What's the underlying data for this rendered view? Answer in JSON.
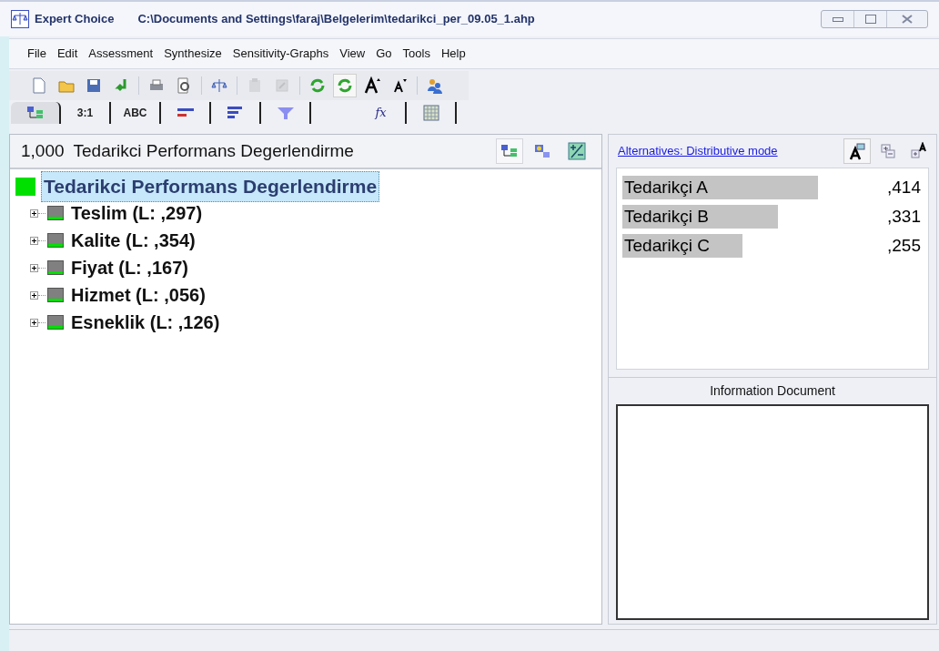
{
  "window": {
    "app_name": "Expert Choice",
    "file_path": "C:\\Documents and Settings\\faraj\\Belgelerim\\tedarikci_per_09.05_1.ahp"
  },
  "menu": [
    {
      "label": "File"
    },
    {
      "label": "Edit"
    },
    {
      "label": "Assessment"
    },
    {
      "label": "Synthesize"
    },
    {
      "label": "Sensitivity-Graphs"
    },
    {
      "label": "View"
    },
    {
      "label": "Go"
    },
    {
      "label": "Tools"
    },
    {
      "label": "Help"
    }
  ],
  "toolbar": [
    {
      "kind": "new",
      "disabled": false,
      "pressed": false
    },
    {
      "kind": "open",
      "disabled": false,
      "pressed": false
    },
    {
      "kind": "save",
      "disabled": false,
      "pressed": false
    },
    {
      "kind": "back",
      "disabled": false,
      "pressed": false
    },
    {
      "kind": "sep"
    },
    {
      "kind": "print",
      "disabled": false,
      "pressed": false
    },
    {
      "kind": "preview",
      "disabled": false,
      "pressed": false
    },
    {
      "kind": "sep"
    },
    {
      "kind": "scale",
      "disabled": false,
      "pressed": false
    },
    {
      "kind": "sep"
    },
    {
      "kind": "paste",
      "disabled": true,
      "pressed": false
    },
    {
      "kind": "edit",
      "disabled": true,
      "pressed": false
    },
    {
      "kind": "sep"
    },
    {
      "kind": "refresh",
      "disabled": false,
      "pressed": false
    },
    {
      "kind": "refresh",
      "disabled": false,
      "pressed": true
    },
    {
      "kind": "font_up",
      "disabled": false,
      "pressed": false
    },
    {
      "kind": "font_down",
      "disabled": false,
      "pressed": false
    },
    {
      "kind": "sep"
    },
    {
      "kind": "users",
      "disabled": false,
      "pressed": false
    }
  ],
  "tabs": [
    {
      "kind": "tree",
      "selected": true
    },
    {
      "kind": "text",
      "label": "3:1",
      "selected": false
    },
    {
      "kind": "text",
      "label": "ABC",
      "selected": false
    },
    {
      "kind": "bars",
      "selected": false
    },
    {
      "kind": "hbars",
      "selected": false
    },
    {
      "kind": "funnel",
      "selected": false
    },
    {
      "kind": "formula",
      "label": "fx",
      "selected": false
    },
    {
      "kind": "grid",
      "selected": false
    }
  ],
  "goal_header": {
    "priority": "1,000",
    "title": "Tedarikci Performans Degerlendirme"
  },
  "tree": {
    "label": "Tedarikci Performans Degerlendirme",
    "selected": true,
    "children": [
      {
        "label": "Teslim (L: ,297)",
        "expanded": false
      },
      {
        "label": "Kalite (L: ,354)",
        "expanded": false
      },
      {
        "label": "Fiyat (L: ,167)",
        "expanded": false
      },
      {
        "label": "Hizmet (L: ,056)",
        "expanded": false
      },
      {
        "label": "Esneklik (L: ,126)",
        "expanded": false
      }
    ]
  },
  "alternatives": {
    "mode_link": "Alternatives: Distributive mode",
    "items": [
      {
        "name": "Tedarikçi A",
        "value": ",414"
      },
      {
        "name": "Tedarikçi B",
        "value": ",331"
      },
      {
        "name": "Tedarikçi C",
        "value": ",255"
      }
    ]
  },
  "info_document": {
    "title": "Information Document"
  }
}
